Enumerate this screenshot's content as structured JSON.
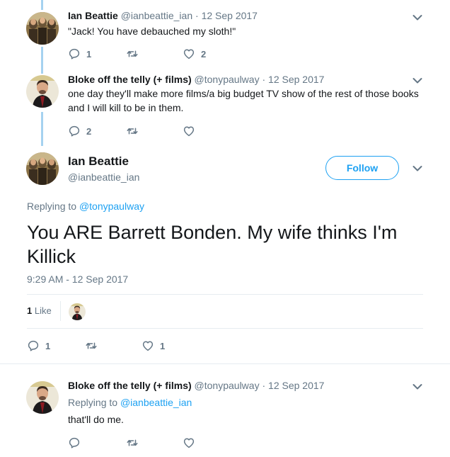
{
  "tweets": [
    {
      "name": "Ian Beattie",
      "handle": "@ianbeattie_ian",
      "separator": "·",
      "date": "12 Sep 2017",
      "text": "\"Jack! You have debauched my sloth!\"",
      "replies": "1",
      "retweets": "",
      "likes": "2"
    },
    {
      "name": "Bloke off the telly (+ films)",
      "handle": "@tonypaulway",
      "separator": "·",
      "date": "12 Sep 2017",
      "text": "one day they'll make more films/a big budget TV show of the rest of those books and I will kill to be in them.",
      "replies": "2",
      "retweets": "",
      "likes": ""
    }
  ],
  "main": {
    "name": "Ian Beattie",
    "handle": "@ianbeattie_ian",
    "follow_label": "Follow",
    "replying_label": "Replying to",
    "replying_to": "@tonypaulway",
    "text": "You ARE Barrett Bonden. My wife thinks I'm Killick",
    "timestamp": "9:29 AM - 12 Sep 2017",
    "like_count": "1",
    "like_label": "Like",
    "replies": "1",
    "retweets": "",
    "likes": "1"
  },
  "reply": {
    "name": "Bloke off the telly (+ films)",
    "handle": "@tonypaulway",
    "separator": "·",
    "date": "12 Sep 2017",
    "replying_label": "Replying to",
    "replying_to": "@ianbeattie_ian",
    "text": "that'll do me.",
    "replies": "",
    "retweets": "",
    "likes": ""
  },
  "colors": {
    "accent": "#1da1f2",
    "muted": "#657786",
    "thread_line": "#a5d2f0",
    "divider": "#e6ecf0"
  },
  "icons": [
    "reply-icon",
    "retweet-icon",
    "like-icon",
    "chevron-down-icon"
  ]
}
